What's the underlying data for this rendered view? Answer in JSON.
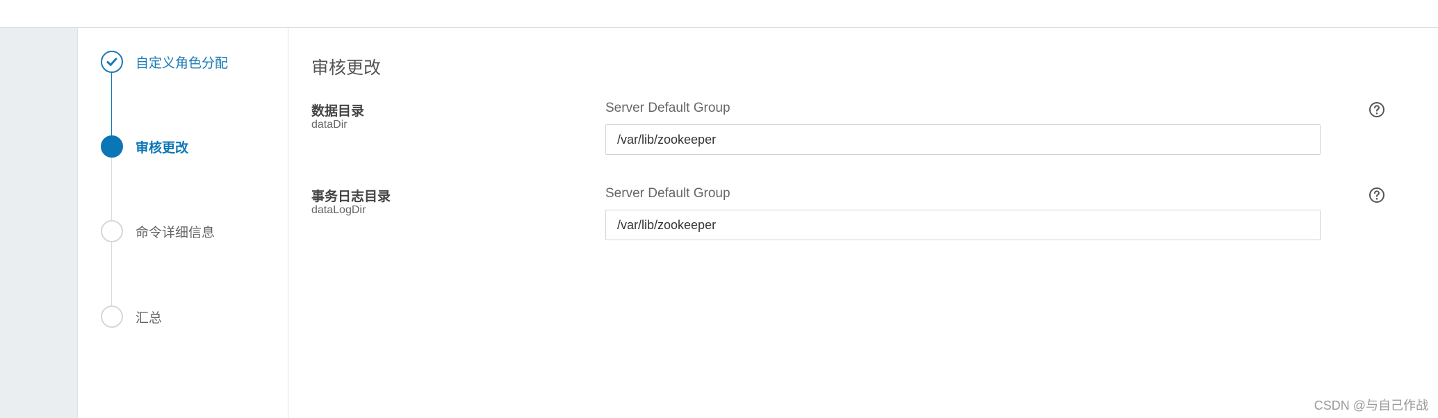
{
  "steps": [
    {
      "label": "自定义角色分配",
      "state": "completed",
      "icon": "check-icon"
    },
    {
      "label": "审核更改",
      "state": "current",
      "icon": "filled-circle-icon"
    },
    {
      "label": "命令详细信息",
      "state": "pending",
      "icon": "empty-circle-icon"
    },
    {
      "label": "汇总",
      "state": "pending",
      "icon": "empty-circle-icon"
    }
  ],
  "main": {
    "title": "审核更改",
    "properties": [
      {
        "display_name": "数据目录",
        "key": "dataDir",
        "group": "Server Default Group",
        "value": "/var/lib/zookeeper",
        "help_icon": "question-circle-icon"
      },
      {
        "display_name": "事务日志目录",
        "key": "dataLogDir",
        "group": "Server Default Group",
        "value": "/var/lib/zookeeper",
        "help_icon": "question-circle-icon"
      }
    ]
  },
  "watermark": "CSDN @与自己作战",
  "colors": {
    "accent": "#0a76b6",
    "completed": "#1a7ab5",
    "pending_circle": "#d4d8db",
    "gutter_bg": "#eaeef0"
  }
}
